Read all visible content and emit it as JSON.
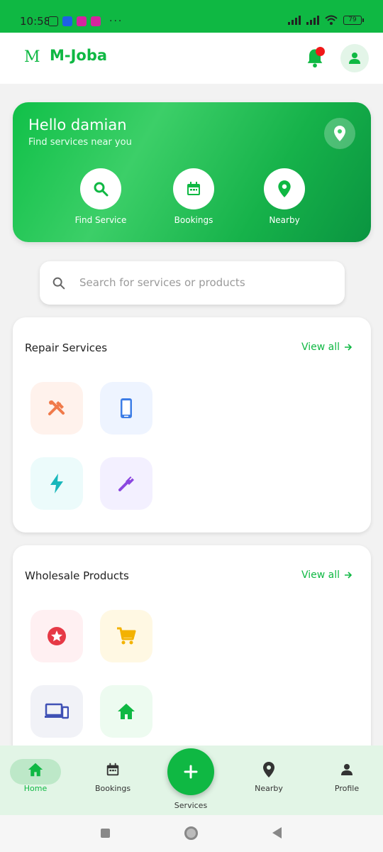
{
  "status_bar": {
    "time": "10:58",
    "battery": "79",
    "more": "···"
  },
  "header": {
    "logo_mark": "M",
    "title": "M-Joba"
  },
  "hero": {
    "greeting": "Hello damian",
    "subtitle": "Find services near you",
    "actions": [
      {
        "label": "Find Service",
        "icon": "search-icon"
      },
      {
        "label": "Bookings",
        "icon": "calendar-icon"
      },
      {
        "label": "Nearby",
        "icon": "location-pin-icon"
      }
    ]
  },
  "search": {
    "placeholder": "Search for services or products"
  },
  "repair": {
    "title": "Repair Services",
    "view_all": "View all",
    "tiles": [
      {
        "icon": "tools-icon",
        "bg": "#fff2ec",
        "color": "#f07a4a"
      },
      {
        "icon": "phone-icon",
        "bg": "#eef4ff",
        "color": "#3d7de6"
      },
      {
        "icon": "lightning-icon",
        "bg": "#ecfbfb",
        "color": "#19b7bb"
      },
      {
        "icon": "plumbing-icon",
        "bg": "#f3f0ff",
        "color": "#8b46e0"
      }
    ]
  },
  "wholesale": {
    "title": "Wholesale Products",
    "view_all": "View all",
    "tiles": [
      {
        "icon": "star-badge-icon",
        "bg": "#fff0f2",
        "color": "#e63946"
      },
      {
        "icon": "cart-icon",
        "bg": "#fff8e3",
        "color": "#f3b200"
      },
      {
        "icon": "devices-icon",
        "bg": "#f1f2f7",
        "color": "#4051b5"
      },
      {
        "icon": "home-icon",
        "bg": "#edfbf0",
        "color": "#0fb843"
      }
    ]
  },
  "bottom_nav": {
    "items": [
      {
        "label": "Home",
        "icon": "home-icon",
        "active": true
      },
      {
        "label": "Bookings",
        "icon": "calendar-icon"
      },
      {
        "label": "Services",
        "icon": "plus-icon"
      },
      {
        "label": "Nearby",
        "icon": "location-pin-icon"
      },
      {
        "label": "Profile",
        "icon": "person-icon"
      }
    ]
  },
  "colors": {
    "primary": "#0fb843",
    "notification": "#f01818"
  }
}
